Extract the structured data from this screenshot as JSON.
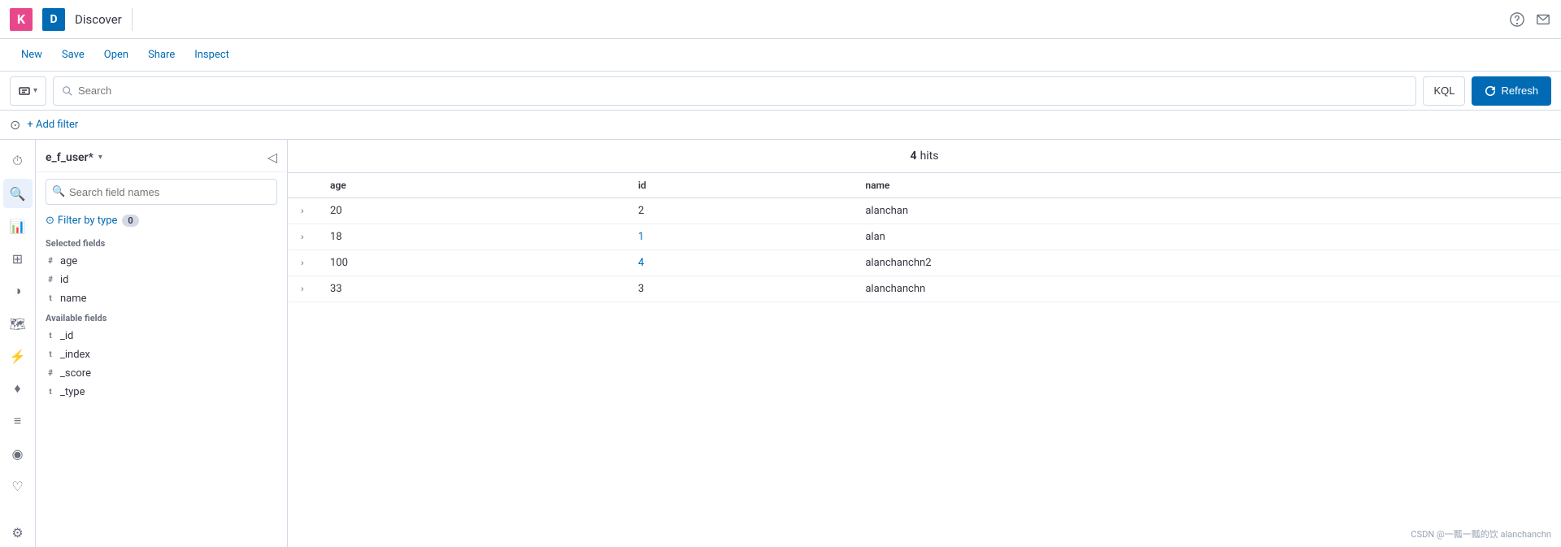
{
  "topbar": {
    "logo_k": "K",
    "logo_d": "D",
    "page_title": "Discover"
  },
  "menu": {
    "items": [
      "New",
      "Save",
      "Open",
      "Share",
      "Inspect"
    ]
  },
  "searchbar": {
    "search_placeholder": "Search",
    "index_label": "",
    "kql_label": "KQL",
    "refresh_label": "Refresh"
  },
  "filterbar": {
    "add_filter_label": "+ Add filter"
  },
  "sidebar": {
    "index_name": "e_f_user*",
    "search_placeholder": "Search field names",
    "filter_by_type_label": "Filter by type",
    "filter_count": "0",
    "selected_fields_label": "Selected fields",
    "selected_fields": [
      {
        "type": "#",
        "name": "age"
      },
      {
        "type": "#",
        "name": "id"
      },
      {
        "type": "t",
        "name": "name"
      }
    ],
    "available_fields_label": "Available fields",
    "available_fields": [
      {
        "type": "t",
        "name": "_id"
      },
      {
        "type": "t",
        "name": "_index"
      },
      {
        "type": "#",
        "name": "_score"
      },
      {
        "type": "t",
        "name": "_type"
      }
    ]
  },
  "table": {
    "hits_count": "4",
    "hits_label": "hits",
    "columns": [
      "age",
      "id",
      "name"
    ],
    "rows": [
      {
        "age": "20",
        "id": "2",
        "name": "alanchan",
        "id_linked": false
      },
      {
        "age": "18",
        "id": "1",
        "name": "alan",
        "id_linked": true
      },
      {
        "age": "100",
        "id": "4",
        "name": "alanchanchn2",
        "id_linked": true
      },
      {
        "age": "33",
        "id": "3",
        "name": "alanchanchn",
        "id_linked": false
      }
    ]
  },
  "watermark": "CSDN @一瓢一瓢的饮 alanchanchn"
}
